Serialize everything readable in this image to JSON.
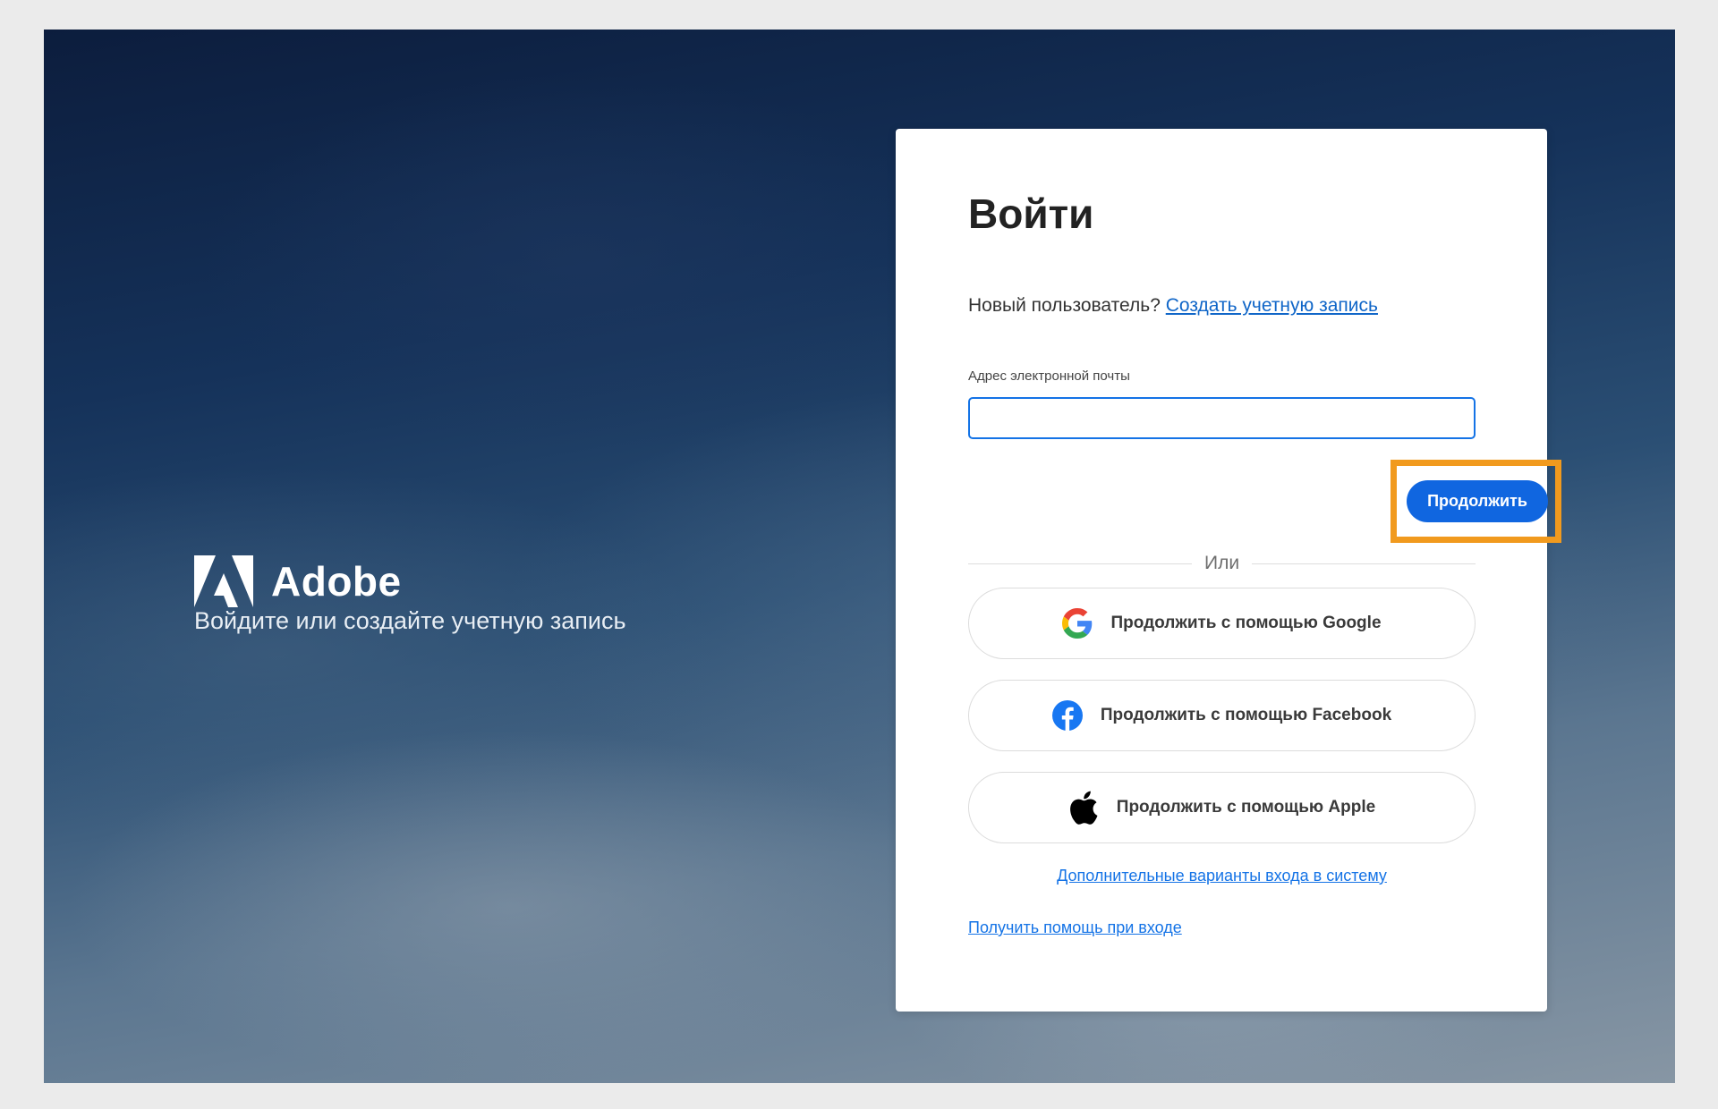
{
  "brand": {
    "name": "Adobe",
    "tagline": "Войдите или создайте учетную запись"
  },
  "signin": {
    "title": "Войти",
    "new_user_prompt": "Новый пользователь?",
    "create_account_link": "Создать учетную запись",
    "email_label": "Адрес электронной почты",
    "email_value": "",
    "continue_label": "Продолжить",
    "or_label": "Или",
    "social": [
      {
        "label": "Продолжить с помощью Google",
        "icon": "google-icon"
      },
      {
        "label": "Продолжить с помощью Facebook",
        "icon": "facebook-icon"
      },
      {
        "label": "Продолжить с помощью Apple",
        "icon": "apple-icon"
      }
    ],
    "more_options_link": "Дополнительные варианты входа в систему",
    "help_link": "Получить помощь при входе"
  },
  "colors": {
    "accent": "#1473e6",
    "highlight": "#f19a1e",
    "facebook": "#1877f2"
  }
}
